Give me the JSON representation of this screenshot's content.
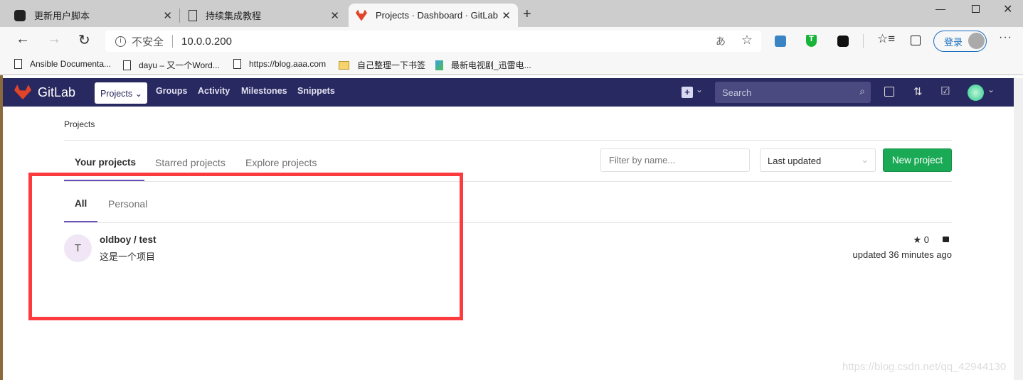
{
  "browser": {
    "tabs": [
      {
        "title": "更新用户脚本",
        "active": false
      },
      {
        "title": "持续集成教程",
        "active": false
      },
      {
        "title": "Projects · Dashboard · GitLab",
        "active": true
      }
    ],
    "security_label": "不安全",
    "url": "10.0.0.200",
    "login_label": "登录",
    "bookmarks": [
      "Ansible Documenta...",
      "dayu – 又一个Word...",
      "https://blog.aaa.com",
      "自己整理一下书签",
      "最新电视剧_迅雷电..."
    ]
  },
  "gitlab": {
    "brand": "GitLab",
    "nav": [
      "Projects",
      "Groups",
      "Activity",
      "Milestones",
      "Snippets"
    ],
    "search_placeholder": "Search",
    "accent": "#292961"
  },
  "page": {
    "breadcrumb": "Projects",
    "tabs": [
      "Your projects",
      "Starred projects",
      "Explore projects"
    ],
    "filter_placeholder": "Filter by name...",
    "sort": "Last updated",
    "new_project": "New project",
    "subtabs": [
      "All",
      "Personal"
    ],
    "projects": [
      {
        "avatar": "T",
        "name": "oldboy / test",
        "description": "这是一个项目",
        "stars": "0",
        "updated": "updated 36 minutes ago",
        "visibility": "private"
      }
    ]
  },
  "watermark": "https://blog.csdn.net/qq_42944130"
}
